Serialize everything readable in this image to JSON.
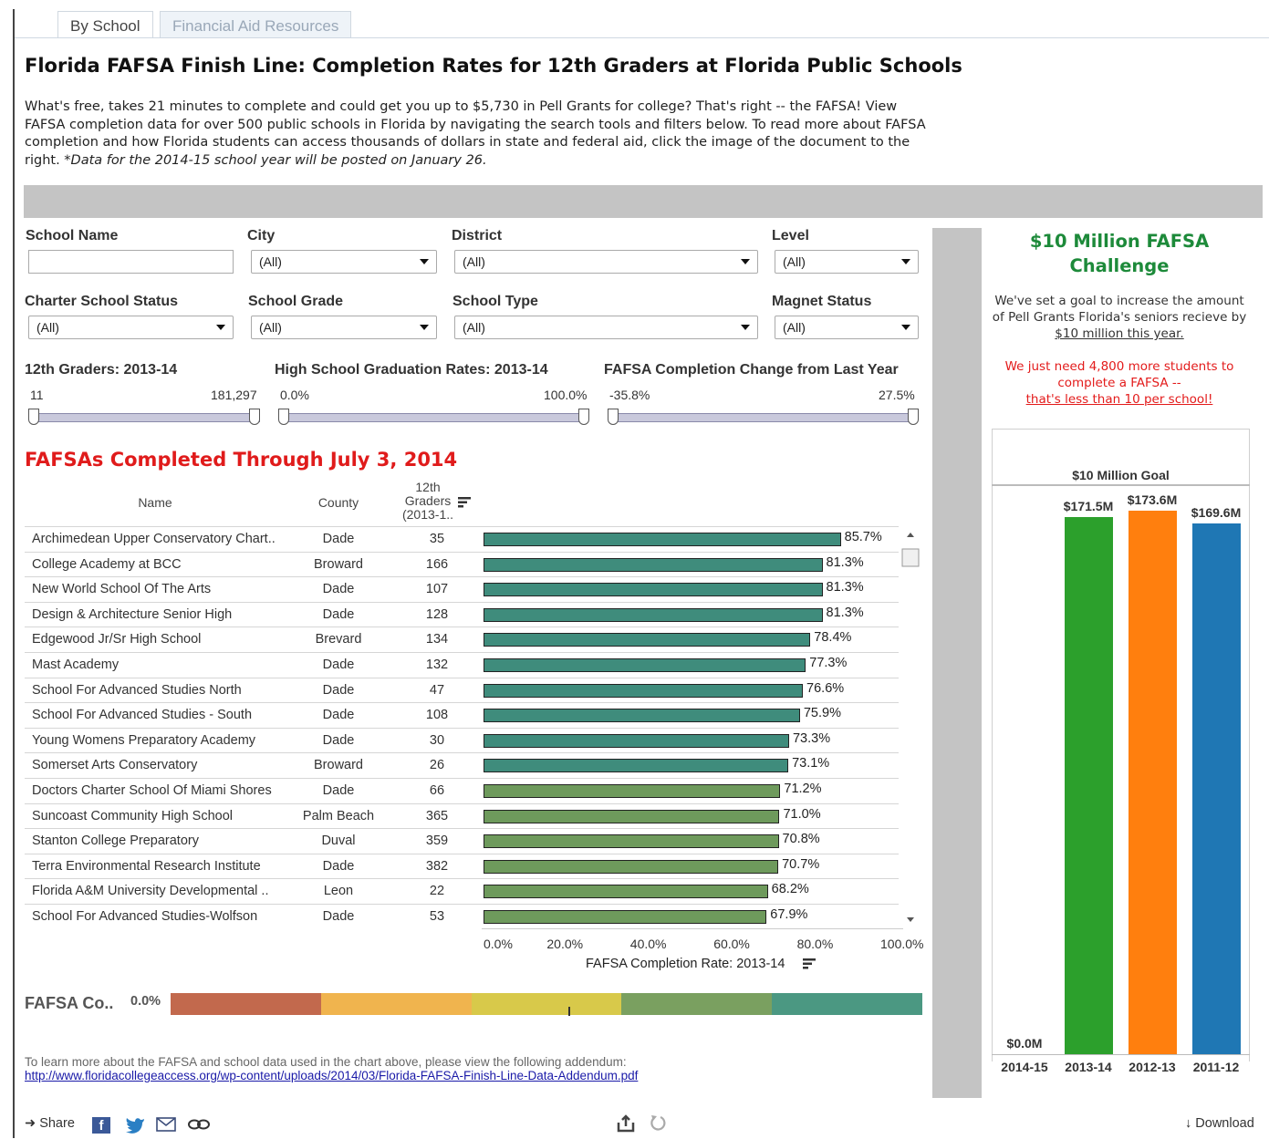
{
  "tabs": [
    {
      "label": "By School",
      "active": true
    },
    {
      "label": "Financial Aid Resources",
      "active": false
    }
  ],
  "title": "Florida FAFSA Finish Line: Completion Rates for 12th Graders at Florida Public Schools",
  "intro": {
    "text": "What's free, takes 21 minutes to complete and could get you up to $5,730 in Pell Grants for college?  That's right -- the FAFSA!  View FAFSA completion data for over 500 public schools in Florida by navigating the search tools and filters below.  To read more about FAFSA completion and how Florida students can access thousands of dollars in state and federal aid, click the image of the document to the right.  ",
    "note": "*Data for the 2014-15 school year will be posted on January 26."
  },
  "filters": {
    "school_name": {
      "label": "School Name",
      "value": ""
    },
    "city": {
      "label": "City",
      "value": "(All)"
    },
    "district": {
      "label": "District",
      "value": "(All)"
    },
    "level": {
      "label": "Level",
      "value": "(All)"
    },
    "charter": {
      "label": "Charter School Status",
      "value": "(All)"
    },
    "grade": {
      "label": "School Grade",
      "value": "(All)"
    },
    "type": {
      "label": "School Type",
      "value": "(All)"
    },
    "magnet": {
      "label": "Magnet Status",
      "value": "(All)"
    }
  },
  "sliders": {
    "graders": {
      "label": "12th Graders: 2013-14",
      "min": "11",
      "max": "181,297"
    },
    "grad_rates": {
      "label": "High School Graduation Rates: 2013-14",
      "min": "0.0%",
      "max": "100.0%"
    },
    "change": {
      "label": "FAFSA Completion Change from Last Year",
      "min": "-35.8%",
      "max": "27.5%"
    }
  },
  "section_title": "FAFSAs Completed Through July 3, 2014",
  "table": {
    "col_name": "Name",
    "col_county": "County",
    "col_graders_1": "12th",
    "col_graders_2": "Graders",
    "col_graders_3": "(2013-1..",
    "axis_label": "FAFSA Completion Rate: 2013-14",
    "axis_ticks": [
      "0.0%",
      "20.0%",
      "40.0%",
      "60.0%",
      "80.0%",
      "100.0%"
    ]
  },
  "chart_data": [
    {
      "type": "bar",
      "orientation": "horizontal",
      "title": "FAFSAs Completed Through July 3, 2014",
      "xlabel": "FAFSA Completion Rate: 2013-14",
      "xlim": [
        0,
        100
      ],
      "categories": [
        "Archimedean Upper Conservatory Chart..",
        "College Academy at BCC",
        "New World School Of The Arts",
        "Design & Architecture Senior High",
        "Edgewood Jr/Sr High School",
        "Mast Academy",
        "School For Advanced Studies North",
        "School For Advanced Studies - South",
        "Young Womens Preparatory Academy",
        "Somerset Arts Conservatory",
        "Doctors Charter School Of Miami Shores",
        "Suncoast Community High School",
        "Stanton College Preparatory",
        "Terra Environmental Research Institute",
        "Florida A&M University Developmental ..",
        "School For Advanced Studies-Wolfson"
      ],
      "counties": [
        "Dade",
        "Broward",
        "Dade",
        "Dade",
        "Brevard",
        "Dade",
        "Dade",
        "Dade",
        "Dade",
        "Broward",
        "Dade",
        "Palm Beach",
        "Duval",
        "Dade",
        "Leon",
        "Dade"
      ],
      "graders": [
        35,
        166,
        107,
        128,
        134,
        132,
        47,
        108,
        30,
        26,
        66,
        365,
        359,
        382,
        22,
        53
      ],
      "values": [
        85.7,
        81.3,
        81.3,
        81.3,
        78.4,
        77.3,
        76.6,
        75.9,
        73.3,
        73.1,
        71.2,
        71.0,
        70.8,
        70.7,
        68.2,
        67.9
      ],
      "labels": [
        "85.7%",
        "81.3%",
        "81.3%",
        "81.3%",
        "78.4%",
        "77.3%",
        "76.6%",
        "75.9%",
        "73.3%",
        "73.1%",
        "71.2%",
        "71.0%",
        "70.8%",
        "70.7%",
        "68.2%",
        "67.9%"
      ],
      "colors": {
        "high": "#3f8c7c",
        "mid": "#6e9a5c"
      }
    },
    {
      "type": "bar",
      "title": "$10 Million Goal",
      "categories": [
        "2014-15",
        "2013-14",
        "2012-13",
        "2011-12"
      ],
      "values": [
        0.0,
        171.5,
        173.6,
        169.6
      ],
      "labels": [
        "$0.0M",
        "$171.5M",
        "$173.6M",
        "$169.6M"
      ],
      "colors": [
        "#2ca02c",
        "#2ca02c",
        "#ff7f0e",
        "#1f77b4"
      ]
    }
  ],
  "legend": {
    "label": "FAFSA Co..",
    "value": "0.0%",
    "colors": [
      "#c2694d",
      "#f0b44e",
      "#d8c94a",
      "#7aa060",
      "#4b9882"
    ]
  },
  "right": {
    "title": "$10 Million FAFSA Challenge",
    "text1": "We've set a goal to increase the amount of Pell Grants Florida's seniors recieve by ",
    "text1_link": "$10 million this year.",
    "text2": "We just need 4,800 more students to complete a FAFSA -- ",
    "text2_link": "that's less than 10 per school!",
    "goal_title": "$10 Million Goal"
  },
  "footnote": {
    "text": "To learn more about the FAFSA and school data used in the chart above, please view the following addendum:",
    "link": "http://www.floridacollegeaccess.org/wp-content/uploads/2014/03/Florida-FAFSA-Finish-Line-Data-Addendum.pdf"
  },
  "bottom": {
    "share": "Share",
    "download": "Download"
  }
}
